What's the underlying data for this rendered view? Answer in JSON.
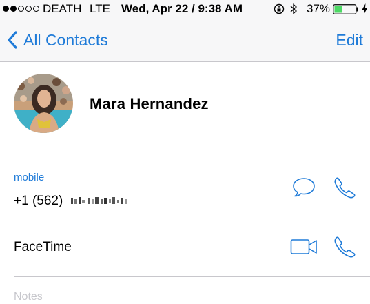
{
  "status_bar": {
    "carrier": "DEATH",
    "network": "LTE",
    "datetime": "Wed, Apr 22 / 9:38 AM",
    "battery_percent": "37%",
    "battery_level": 0.37,
    "signal_strength": 2,
    "signal_max": 5
  },
  "nav": {
    "back_label": "All Contacts",
    "edit_label": "Edit"
  },
  "contact": {
    "name": "Mara Hernandez",
    "phone_label": "mobile",
    "phone_number_visible": "+1 (562)",
    "facetime_label": "FaceTime",
    "notes_label": "Notes"
  },
  "colors": {
    "accent": "#1f7bd8",
    "battery": "#4cd964",
    "divider": "#c8c7cc"
  },
  "icons": [
    "back-chevron-icon",
    "message-icon",
    "phone-icon",
    "facetime-video-icon",
    "facetime-audio-icon",
    "orientation-lock-icon",
    "bluetooth-icon",
    "battery-icon",
    "charging-icon"
  ]
}
